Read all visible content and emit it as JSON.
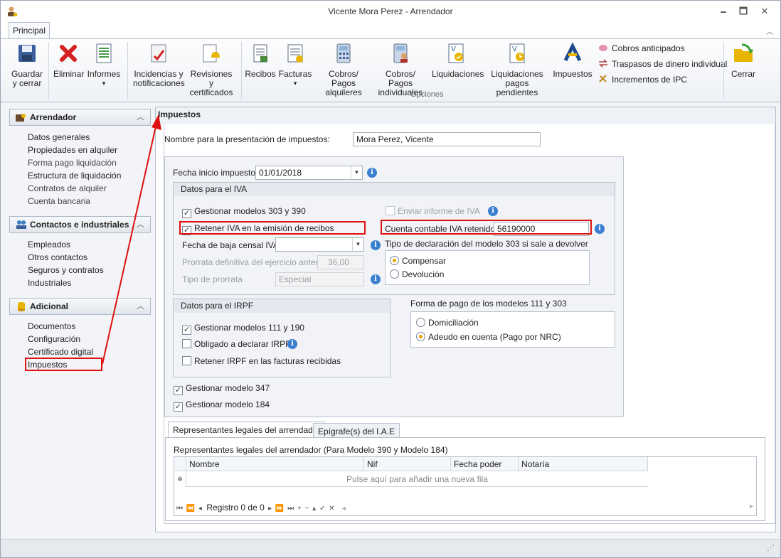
{
  "window": {
    "title": "Vicente Mora Perez - Arrendador",
    "min": "🗕",
    "max": "🗖",
    "close": "✕"
  },
  "ribbon": {
    "tab": "Principal",
    "collapse": "︿",
    "buttons": {
      "guardar_1": "Guardar",
      "guardar_2": "y cerrar",
      "eliminar": "Eliminar",
      "informes": "Informes",
      "informes_arrow": "▾",
      "incidencias_1": "Incidencias y",
      "incidencias_2": "notificaciones",
      "revisiones_1": "Revisiones y",
      "revisiones_2": "certificados",
      "recibos": "Recibos",
      "facturas": "Facturas",
      "facturas_arrow": "▾",
      "cobros_1": "Cobros/ Pagos",
      "cobros_2": "alquileres",
      "cobros_ind_1": "Cobros/ Pagos",
      "cobros_ind_2": "individuales",
      "liquidaciones": "Liquidaciones",
      "liq_pend_1": "Liquidaciones",
      "liq_pend_2": "pagos pendientes",
      "impuestos": "Impuestos",
      "cobros_anticipados": "Cobros anticipados",
      "traspasos": "Traspasos de dinero individual",
      "incrementos": "Incrementos de IPC",
      "cerrar": "Cerrar"
    },
    "group_label": "Opciones"
  },
  "sidebar": {
    "arrendador": {
      "title": "Arrendador",
      "chev": "︿",
      "items": [
        "Datos generales",
        "Propiedades en alquiler",
        "Forma pago liquidación",
        "Estructura de liquidación",
        "Contratos de alquiler",
        "Cuenta bancaria"
      ]
    },
    "contactos": {
      "title": "Contactos e industriales",
      "chev": "︿",
      "items": [
        "Empleados",
        "Otros contactos",
        "Seguros y contratos",
        "Industriales"
      ]
    },
    "adicional": {
      "title": "Adicional",
      "chev": "︿",
      "items": [
        "Documentos",
        "Configuración",
        "Certificado digital",
        "Impuestos"
      ]
    }
  },
  "main": {
    "title": "Impuestos",
    "nombre_label": "Nombre para la presentación de impuestos:",
    "nombre_value": "Mora Perez, Vicente",
    "fecha_inicio_label": "Fecha inicio impuestos:",
    "fecha_inicio_value": "01/01/2018",
    "info": "i",
    "dd": "▼",
    "iva": {
      "header": "Datos para el IVA",
      "gestionar": "Gestionar modelos 303 y 390",
      "retener": "Retener IVA en la emisión de recibos",
      "baja_label": "Fecha de baja censal IVA",
      "prorrata_label": "Prorrata definitiva del ejercicio anterior",
      "prorrata_value": "36,00",
      "tipo_label": "Tipo de prorrata",
      "tipo_value": "Especial",
      "enviar": "Enviar informe de IVA",
      "cuenta_label": "Cuenta contable IVA retenido:",
      "cuenta_value": "56190000",
      "tipo_decl_label": "Tipo de declaración del modelo 303 si sale a devolver",
      "compensar": "Compensar",
      "devolucion": "Devolución"
    },
    "irpf": {
      "header": "Datos para el IRPF",
      "gestionar": "Gestionar modelos 111 y 190",
      "obligado": "Obligado a declarar IRPF",
      "retener": "Retener IRPF en las facturas recibidas"
    },
    "forma_pago": {
      "label": "Forma de pago de los modelos 111 y 303",
      "domiciliacion": "Domiciliación",
      "adeudo": "Adeudo en cuenta (Pago por NRC)"
    },
    "modelo347": "Gestionar modelo 347",
    "modelo184": "Gestionar modelo 184",
    "check": "✓",
    "tabs": {
      "representantes": "Representantes legales del arrendador",
      "epigrafe": "Epígrafe(s) del I.A.E"
    },
    "grid": {
      "caption": "Representantes legales del arrendador (Para Modelo 390 y Modelo 184)",
      "columns": [
        "Nombre",
        "Nif",
        "Fecha poder",
        "Notaría"
      ],
      "new_row_marker": "✻",
      "new_row": "Pulse aquí para añadir una nueva fila",
      "nav_left": "⏮ ⏪ ◂",
      "registro": "Registro 0 de 0",
      "nav_right": "▸ ⏩ ⏭ + − ▴ ✓ ✕",
      "scroll_left": "◂",
      "scroll_right": "▸"
    }
  },
  "statusbar": {
    "grip": "⋰"
  }
}
